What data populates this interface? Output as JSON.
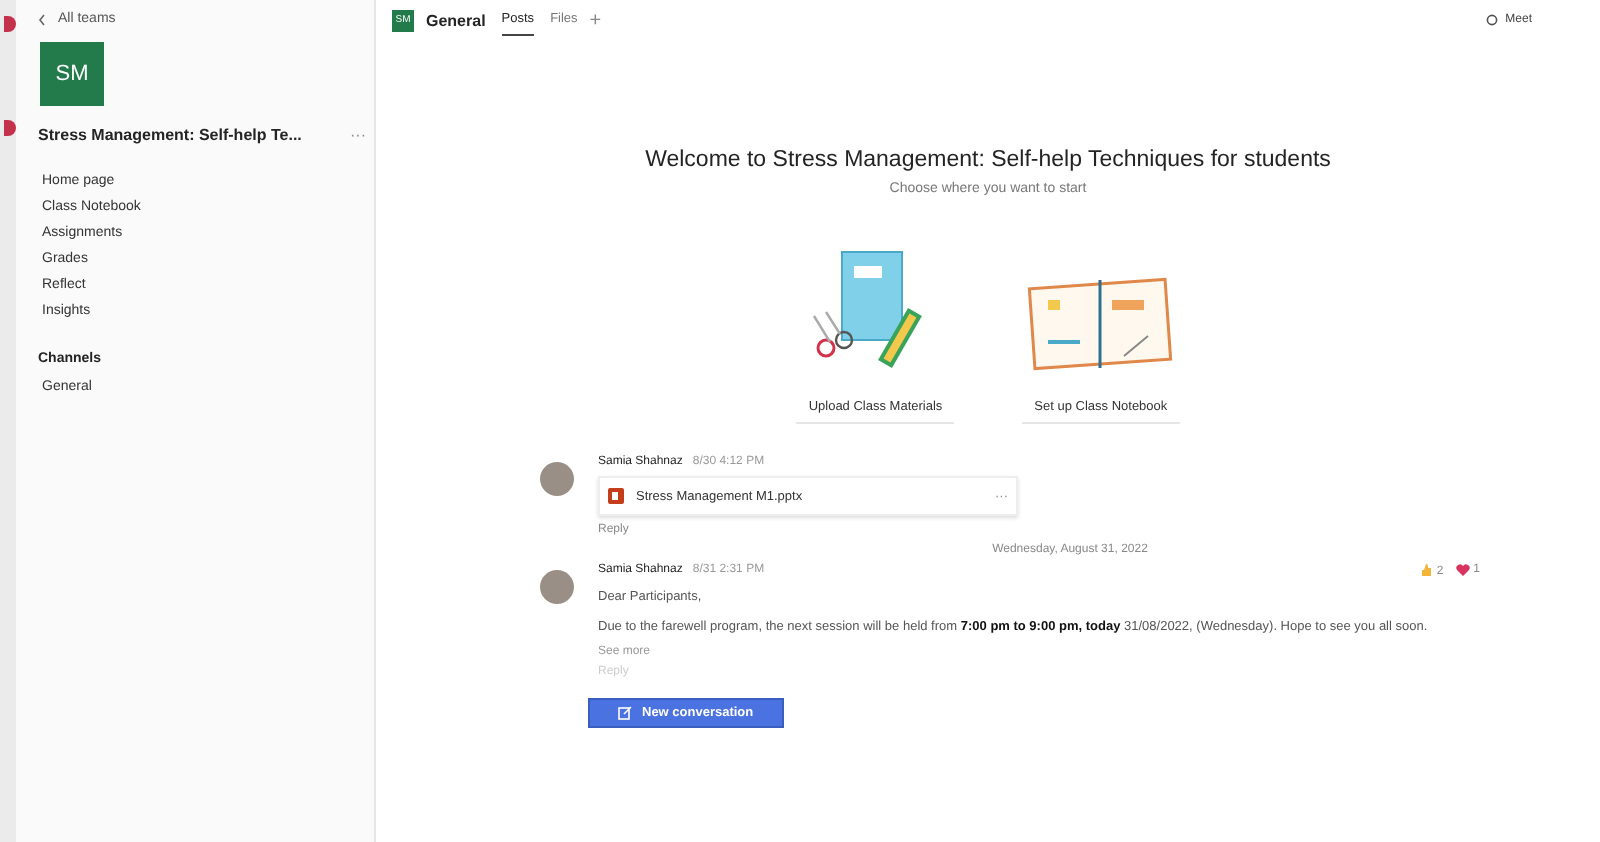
{
  "sidebar": {
    "back_link": "All teams",
    "team_avatar": "SM",
    "team_name": "Stress Management: Self-help Te...",
    "more": "···",
    "items": [
      {
        "label": "Home page",
        "selected": false
      },
      {
        "label": "Class Notebook",
        "selected": false
      },
      {
        "label": "Assignments",
        "selected": false
      },
      {
        "label": "Grades",
        "selected": false
      },
      {
        "label": "Reflect",
        "selected": false
      },
      {
        "label": "Insights",
        "selected": false
      }
    ],
    "channels_heading": "Channels",
    "channels": [
      {
        "label": "General",
        "selected": false
      }
    ]
  },
  "header": {
    "avatar": "SM",
    "channel": "General",
    "tabs": [
      {
        "label": "Posts",
        "selected": true
      },
      {
        "label": "Files",
        "selected": false
      }
    ],
    "add": "+",
    "meet": "Meet"
  },
  "welcome": {
    "title": "Welcome to Stress Management: Self-help Techniques for students",
    "subtitle": "Choose where you want to start",
    "cards": [
      {
        "kind": "materials",
        "label": "Upload Class Materials"
      },
      {
        "kind": "notebook",
        "label": "Set up Class Notebook"
      }
    ]
  },
  "messages": [
    {
      "kind": "file",
      "author": "Samia Shahnaz",
      "time": "8/30 4:12 PM",
      "file": "Stress Management M1.pptx",
      "more": "···",
      "reply": "Reply"
    },
    {
      "kind": "divider",
      "label": "Wednesday, August 31, 2022"
    },
    {
      "kind": "text",
      "author": "Samia Shahnaz",
      "time": "8/31 2:31 PM",
      "greeting": "Dear Participants,",
      "body": "Due to the farewell program, the next session will be held from **7:00 pm to 9:00 pm,  today** 31/08/2022, (Wednesday). Hope to see you all soon.",
      "see_more": "See more",
      "reply": "Reply",
      "reactions": [
        {
          "kind": "thumb",
          "count": "2"
        },
        {
          "kind": "heart",
          "count": "1"
        }
      ]
    }
  ],
  "new_conversation": "New conversation"
}
